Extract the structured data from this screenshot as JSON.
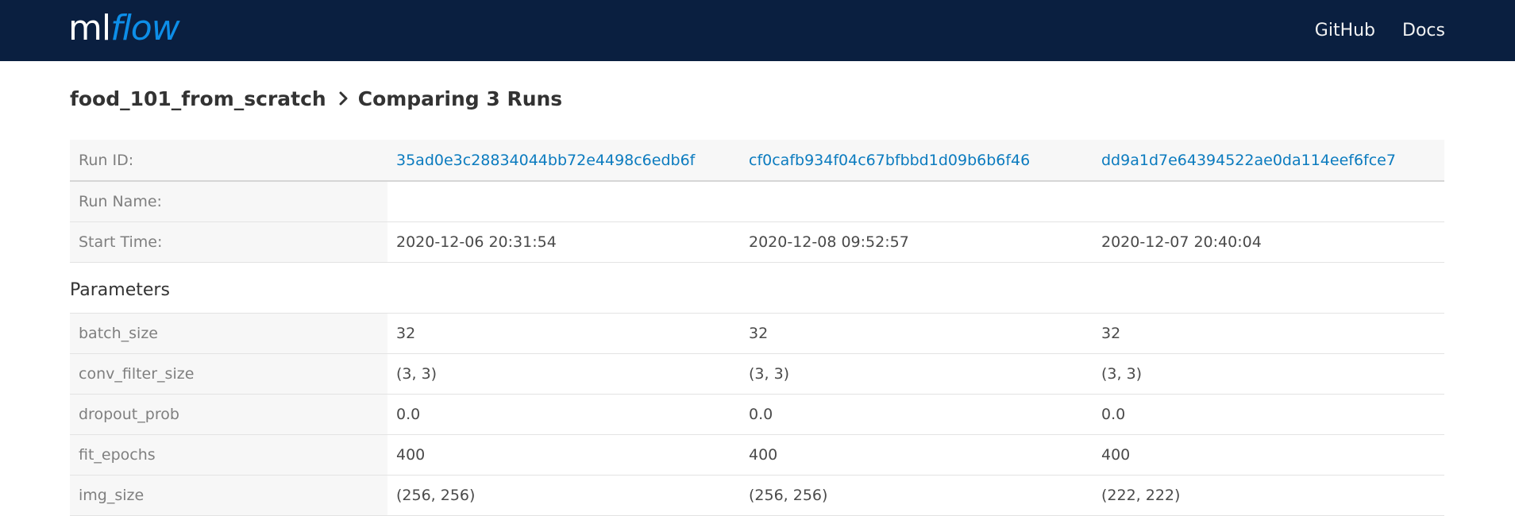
{
  "header": {
    "logo": {
      "part1": "ml",
      "part2": "flow"
    },
    "nav": [
      {
        "label": "GitHub"
      },
      {
        "label": "Docs"
      }
    ]
  },
  "breadcrumb": {
    "experiment": "food_101_from_scratch",
    "separator_icon": "chevron-right-icon",
    "page": "Comparing 3 Runs"
  },
  "runs_table": {
    "run_id_label": "Run ID:",
    "run_name_label": "Run Name:",
    "start_time_label": "Start Time:",
    "runs": [
      {
        "id": "35ad0e3c28834044bb72e4498c6edb6f",
        "name": "",
        "start_time": "2020-12-06 20:31:54"
      },
      {
        "id": "cf0cafb934f04c67bfbbd1d09b6b6f46",
        "name": "",
        "start_time": "2020-12-08 09:52:57"
      },
      {
        "id": "dd9a1d7e64394522ae0da114eef6fce7",
        "name": "",
        "start_time": "2020-12-07 20:40:04"
      }
    ]
  },
  "parameters": {
    "section_title": "Parameters",
    "rows": [
      {
        "name": "batch_size",
        "values": [
          "32",
          "32",
          "32"
        ]
      },
      {
        "name": "conv_filter_size",
        "values": [
          "(3, 3)",
          "(3, 3)",
          "(3, 3)"
        ]
      },
      {
        "name": "dropout_prob",
        "values": [
          "0.0",
          "0.0",
          "0.0"
        ]
      },
      {
        "name": "fit_epochs",
        "values": [
          "400",
          "400",
          "400"
        ]
      },
      {
        "name": "img_size",
        "values": [
          "(256, 256)",
          "(256, 256)",
          "(222, 222)"
        ]
      }
    ]
  },
  "colors": {
    "navbar_bg": "#0a1f40",
    "logo_accent": "#0d8ee8",
    "link": "#0b7bbf"
  }
}
